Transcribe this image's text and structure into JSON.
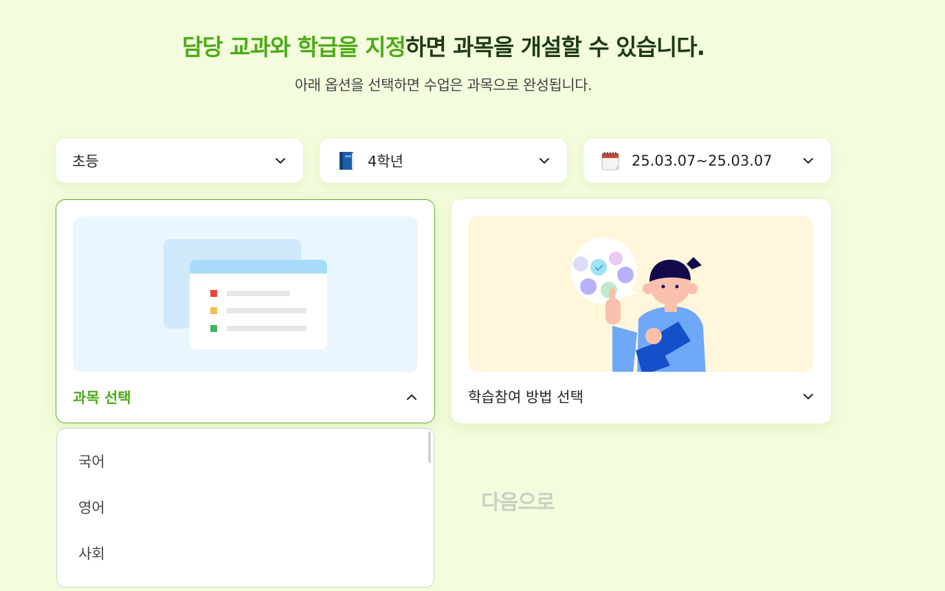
{
  "header": {
    "title_highlight": "담당 교과와 학급을 지정",
    "title_rest": "하면 과목을 개설할 수 있습니다.",
    "subtitle": "아래 옵션을 선택하면 수업은 과목으로 완성됩니다."
  },
  "filters": {
    "level": "초등",
    "grade": "4학년",
    "period": "25.03.07~25.03.07"
  },
  "cards": {
    "subject": {
      "title": "과목 선택"
    },
    "method": {
      "title": "학습참여 방법 선택"
    }
  },
  "subject_dropdown": {
    "options": [
      "국어",
      "영어",
      "사회"
    ]
  },
  "next_label": "다음으로",
  "colors": {
    "accent": "#4caa17",
    "background": "#f3fcdc",
    "disabled": "#c9cfc1"
  },
  "icons": {
    "grade": "blue-book-icon",
    "period": "calendar-icon",
    "dropdown": "chevron-down-icon",
    "collapse": "chevron-up-icon"
  }
}
